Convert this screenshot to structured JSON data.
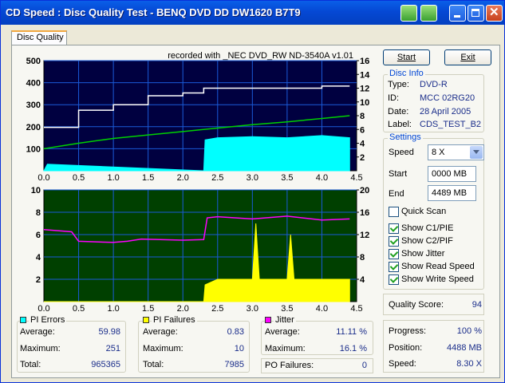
{
  "window": {
    "title": "CD Speed : Disc Quality Test - BENQ     DVD DD DW1620     B7T9"
  },
  "tab": {
    "label": "Disc Quality"
  },
  "chart_top": {
    "type": "area",
    "title": "recorded with _NEC    DVD_RW ND-3540A  v1.01",
    "x_ticks": [
      "0.0",
      "0.5",
      "1.0",
      "1.5",
      "2.0",
      "2.5",
      "3.0",
      "3.5",
      "4.0",
      "4.5"
    ],
    "y_left_ticks": [
      "500",
      "400",
      "300",
      "200",
      "100"
    ],
    "y_right_ticks": [
      "16",
      "14",
      "12",
      "10",
      "8",
      "6",
      "4",
      "2"
    ],
    "xlim": [
      0,
      4.5
    ],
    "ylim_left": [
      0,
      500
    ],
    "ylim_right": [
      0,
      16
    ],
    "colors": {
      "background": "#000040",
      "grid": "#1a5ad8",
      "pie": "#00ffff",
      "read_speed": "#ffffff",
      "write_speed": "#00d000"
    },
    "series": [
      {
        "axis": "left",
        "color": "#00ffff",
        "x": [
          0.0,
          0.05,
          2.3,
          2.32,
          2.5,
          3.0,
          3.5,
          4.0,
          4.4
        ],
        "y": [
          0,
          30,
          0,
          140,
          150,
          155,
          150,
          160,
          150
        ]
      },
      {
        "axis": "right",
        "color": "#00d000",
        "x": [
          0.0,
          0.5,
          1.0,
          1.5,
          2.0,
          2.5,
          3.0,
          3.5,
          4.0,
          4.4
        ],
        "y": [
          3.2,
          4.0,
          4.7,
          5.2,
          5.7,
          6.2,
          6.7,
          7.1,
          7.6,
          8.0
        ]
      },
      {
        "axis": "right",
        "color": "#ffffff",
        "x": [
          0.0,
          0.5,
          0.5,
          1.0,
          1.0,
          1.5,
          1.5,
          2.0,
          2.0,
          2.3,
          2.3,
          2.7,
          2.7,
          3.3,
          3.3,
          4.0,
          4.0,
          4.4
        ],
        "y": [
          6.3,
          6.3,
          8.8,
          8.8,
          9.6,
          9.6,
          10.9,
          10.9,
          11.3,
          11.3,
          12.0,
          12.0,
          12.0,
          12.0,
          12.0,
          12.0,
          12.3,
          12.3
        ]
      }
    ]
  },
  "chart_bottom": {
    "type": "area",
    "x_ticks": [
      "0.0",
      "0.5",
      "1.0",
      "1.5",
      "2.0",
      "2.5",
      "3.0",
      "3.5",
      "4.0",
      "4.5"
    ],
    "y_left_ticks": [
      "10",
      "8",
      "6",
      "4",
      "2"
    ],
    "y_right_ticks": [
      "20",
      "16",
      "12",
      "8",
      "4"
    ],
    "xlim": [
      0,
      4.5
    ],
    "ylim_left": [
      0,
      10
    ],
    "ylim_right": [
      0,
      20
    ],
    "colors": {
      "background": "#004000",
      "grid": "#1a5ad8",
      "pif": "#ffff00",
      "jitter": "#ff00ff"
    },
    "series": [
      {
        "axis": "right",
        "color": "#ff00ff",
        "x": [
          0.0,
          0.4,
          0.5,
          1.0,
          1.2,
          1.4,
          2.0,
          2.3,
          2.35,
          2.5,
          3.0,
          3.5,
          4.0,
          4.4
        ],
        "y": [
          12.9,
          12.5,
          10.8,
          10.6,
          10.8,
          11.2,
          11.0,
          11.1,
          15.0,
          15.2,
          14.8,
          15.3,
          14.6,
          14.8
        ]
      },
      {
        "axis": "left",
        "color": "#ffff00",
        "x": [
          0.0,
          2.3,
          2.32,
          2.5,
          3.0,
          3.05,
          3.1,
          3.5,
          3.55,
          3.6,
          4.0,
          4.4
        ],
        "y": [
          0,
          0,
          1.5,
          2,
          2,
          7,
          2,
          2,
          6,
          2,
          2,
          2
        ]
      }
    ]
  },
  "buttons": {
    "start": "Start",
    "exit": "Exit"
  },
  "disc_info": {
    "title": "Disc Info",
    "type_label": "Type:",
    "type": "DVD-R",
    "id_label": "ID:",
    "id": "MCC 02RG20",
    "date_label": "Date:",
    "date": "28 April 2005",
    "label_label": "Label:",
    "label": "CDS_TEST_B2"
  },
  "settings": {
    "title": "Settings",
    "speed_label": "Speed",
    "speed": "8 X",
    "start_label": "Start",
    "start": "0000 MB",
    "end_label": "End",
    "end": "4489 MB",
    "quick_scan": "Quick Scan",
    "show_c1": "Show C1/PIE",
    "show_c2": "Show C2/PIF",
    "show_jitter": "Show Jitter",
    "show_read": "Show Read Speed",
    "show_write": "Show Write Speed"
  },
  "quality": {
    "label": "Quality Score:",
    "value": "94"
  },
  "progress": {
    "progress_label": "Progress:",
    "progress": "100 %",
    "position_label": "Position:",
    "position": "4488 MB",
    "speed_label": "Speed:",
    "speed": "8.30 X"
  },
  "pi_errors": {
    "title": "PI Errors",
    "color": "#00ffff",
    "average_label": "Average:",
    "average": "59.98",
    "maximum_label": "Maximum:",
    "maximum": "251",
    "total_label": "Total:",
    "total": "965365"
  },
  "pi_failures": {
    "title": "PI Failures",
    "color": "#ffff00",
    "average_label": "Average:",
    "average": "0.83",
    "maximum_label": "Maximum:",
    "maximum": "10",
    "total_label": "Total:",
    "total": "7985"
  },
  "jitter": {
    "title": "Jitter",
    "color": "#ff00ff",
    "average_label": "Average:",
    "average": "11.11 %",
    "maximum_label": "Maximum:",
    "maximum": "16.1 %"
  },
  "po_failures": {
    "label": "PO Failures:",
    "value": "0"
  }
}
